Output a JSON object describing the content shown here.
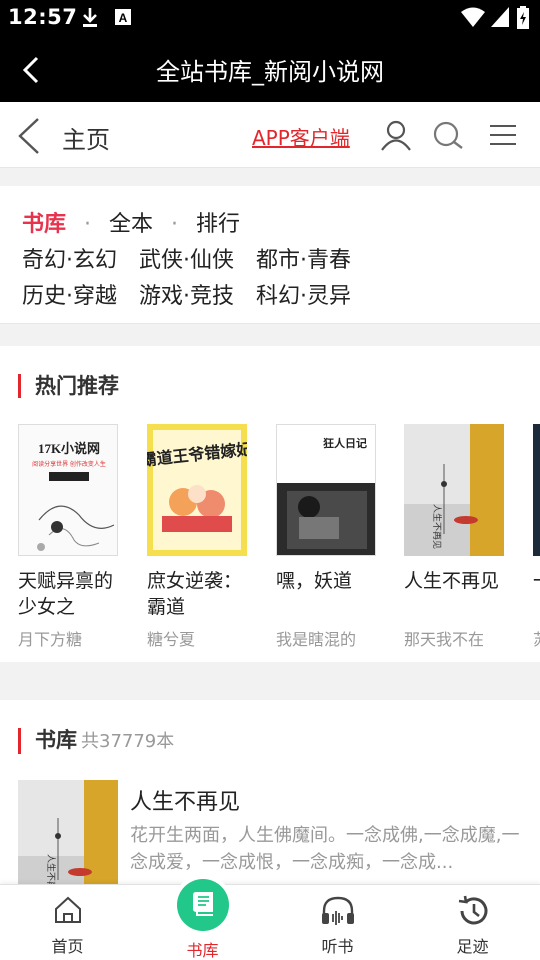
{
  "status_bar": {
    "time": "12:57"
  },
  "app_header": {
    "title": "全站书库_新阅小说网"
  },
  "web_nav": {
    "home_label": "主页",
    "app_link": "APP客户端"
  },
  "categories": {
    "row1": {
      "active": "书库",
      "item2": "全本",
      "item3": "排行"
    },
    "row2": [
      "奇幻·玄幻",
      "武侠·仙侠",
      "都市·青春"
    ],
    "row3": [
      "历史·穿越",
      "游戏·竞技",
      "科幻·灵异"
    ]
  },
  "hot": {
    "title": "热门推荐",
    "books": [
      {
        "name": "天赋异禀的少女之",
        "author": "月下方糖",
        "cover_text": "17K小说网",
        "cover_sub": "阅读分享世界 创作改变人生"
      },
      {
        "name": "庶女逆袭：霸道",
        "author": "糖兮夏",
        "cover_text": "霸道王爷错嫁妃"
      },
      {
        "name": "嘿，妖道",
        "author": "我是瞎混的",
        "cover_text": "狂人日记"
      },
      {
        "name": "人生不再见",
        "author": "那天我不在",
        "cover_text": "人生不再见"
      },
      {
        "name": "一",
        "author": "苏"
      }
    ]
  },
  "library": {
    "title": "书库",
    "count": "共37779本",
    "book": {
      "title": "人生不再见",
      "desc": "花开生两面，人生佛魔间。一念成佛,一念成魔,一念成爱，一念成恨，一念成痴，一念成..."
    }
  },
  "tabs": [
    {
      "label": "首页",
      "icon": "home-icon"
    },
    {
      "label": "书库",
      "icon": "book-icon"
    },
    {
      "label": "听书",
      "icon": "headphones-icon"
    },
    {
      "label": "足迹",
      "icon": "history-icon"
    }
  ],
  "colors": {
    "accent": "#e3262b",
    "active_tab": "#22c78a",
    "category_active": "#e8334d"
  }
}
